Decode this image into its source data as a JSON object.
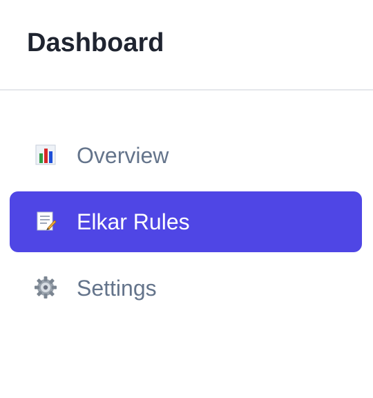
{
  "header": {
    "title": "Dashboard"
  },
  "nav": {
    "items": [
      {
        "label": "Overview",
        "icon": "bar-chart-icon",
        "active": false
      },
      {
        "label": "Elkar Rules",
        "icon": "memo-icon",
        "active": true
      },
      {
        "label": "Settings",
        "icon": "gear-icon",
        "active": false
      }
    ]
  },
  "colors": {
    "active_bg": "#4f46e5",
    "active_text": "#ffffff",
    "inactive_text": "#64748b",
    "title_text": "#1f2430",
    "divider": "#e5e7eb"
  }
}
